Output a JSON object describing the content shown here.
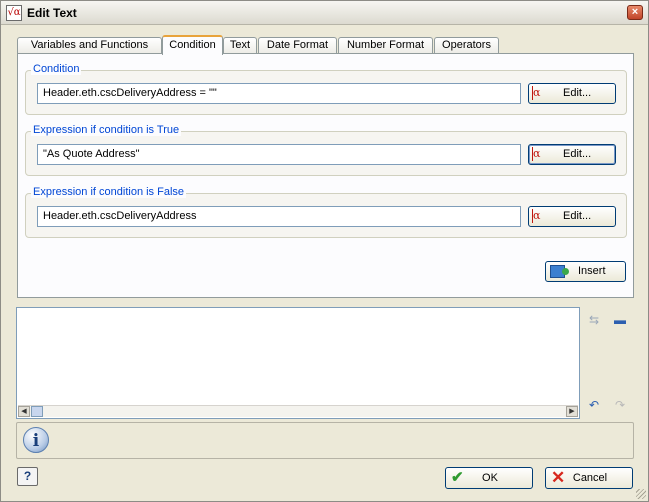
{
  "window": {
    "title": "Edit Text",
    "icon": "sqrt-alpha-icon",
    "close_symbol": "×"
  },
  "tabs": [
    {
      "label": "Variables and Functions",
      "active": false
    },
    {
      "label": "Condition",
      "active": true
    },
    {
      "label": "Text",
      "active": false
    },
    {
      "label": "Date Format",
      "active": false
    },
    {
      "label": "Number Format",
      "active": false
    },
    {
      "label": "Operators",
      "active": false
    }
  ],
  "condition_group": {
    "label": "Condition",
    "value": "Header.eth.cscDeliveryAddress = \"\"",
    "button_label": "Edit..."
  },
  "true_group": {
    "label": "Expression if condition is True",
    "value": "\"As Quote Address\"",
    "button_label": "Edit..."
  },
  "false_group": {
    "label": "Expression if condition is False",
    "value": "Header.eth.cscDeliveryAddress",
    "button_label": "Edit..."
  },
  "insert_button": {
    "label": "Insert",
    "icon": "insert-icon"
  },
  "editor": {
    "value": ""
  },
  "info_panel": {
    "icon": "info-icon",
    "text": ""
  },
  "footer": {
    "help_label": "?",
    "ok_label": "OK",
    "cancel_label": "Cancel"
  },
  "colors": {
    "group_label": "#0046d5",
    "active_tab_accent": "#e8a33b",
    "ok_icon": "#2f9a2f",
    "cancel_icon": "#d7281e"
  }
}
